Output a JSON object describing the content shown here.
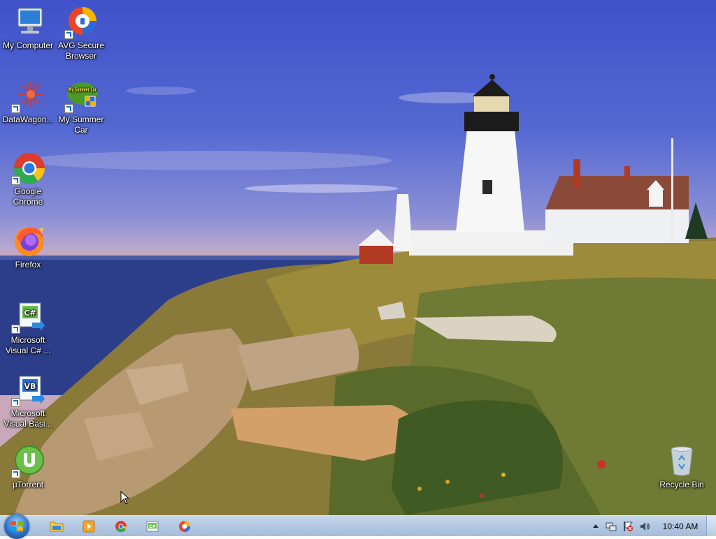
{
  "desktop": {
    "icons": [
      {
        "label": "My Computer"
      },
      {
        "label": "AVG Secure Browser"
      },
      {
        "label": "DataWagon..."
      },
      {
        "label": "My Summer Car"
      },
      {
        "label": "Google Chrome"
      },
      {
        "label": "Firefox"
      },
      {
        "label": "Microsoft Visual C# ..."
      },
      {
        "label": "Microsoft Visual Basi..."
      },
      {
        "label": "µTorrent"
      },
      {
        "label": "Recycle Bin"
      }
    ],
    "icon_badges": {
      "csharp": "C#",
      "vb": "VB",
      "summer": "My Summer Car"
    }
  },
  "taskbar": {
    "pinned": [
      {
        "name": "file-explorer-icon"
      },
      {
        "name": "media-player-icon"
      },
      {
        "name": "chrome-icon"
      },
      {
        "name": "visual-csharp-icon"
      },
      {
        "name": "avg-browser-icon"
      }
    ],
    "csharp_badge": "C#",
    "clock": "10:40 AM"
  },
  "colors": {
    "sky": "#4a5fd0",
    "taskbar": "#b4c8e2",
    "start_orb": "#2c72c8"
  }
}
